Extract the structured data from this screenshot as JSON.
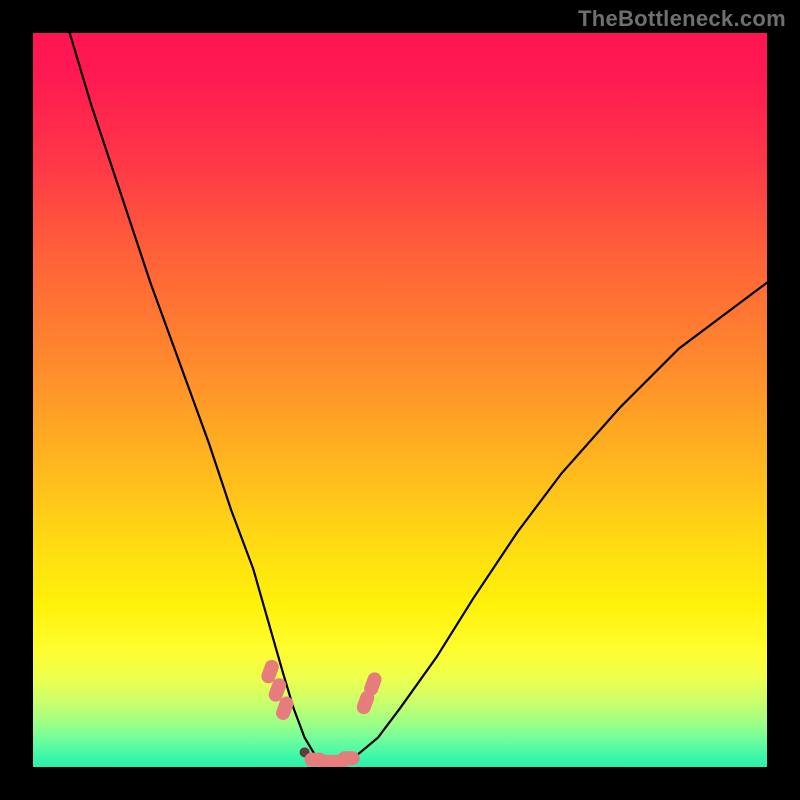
{
  "watermark": "TheBottleneck.com",
  "chart_data": {
    "type": "line",
    "title": "",
    "xlabel": "",
    "ylabel": "",
    "xlim": [
      0,
      100
    ],
    "ylim": [
      0,
      100
    ],
    "axes_visible": false,
    "background": "red-yellow-green vertical gradient",
    "series": [
      {
        "name": "bottleneck-curve",
        "x": [
          5,
          8,
          12,
          16,
          20,
          24,
          27,
          30,
          32,
          34,
          35.5,
          37,
          38.5,
          40,
          42,
          44,
          47,
          50,
          55,
          60,
          66,
          72,
          80,
          88,
          96,
          100
        ],
        "values": [
          100,
          90,
          78,
          66,
          55,
          44,
          35,
          27,
          20,
          13,
          8,
          4,
          1.5,
          0.5,
          0.5,
          1.5,
          4,
          8,
          15,
          23,
          32,
          40,
          49,
          57,
          63,
          66
        ]
      }
    ],
    "markers": [
      {
        "x": 32.3,
        "y": 13.0,
        "kind": "pill"
      },
      {
        "x": 33.3,
        "y": 10.5,
        "kind": "pill"
      },
      {
        "x": 34.3,
        "y": 8.0,
        "kind": "pill"
      },
      {
        "x": 37.0,
        "y": 2.0,
        "kind": "dot-dark"
      },
      {
        "x": 38.5,
        "y": 1.0,
        "kind": "pill-h"
      },
      {
        "x": 40.0,
        "y": 0.7,
        "kind": "pill-h"
      },
      {
        "x": 41.5,
        "y": 0.7,
        "kind": "pill-h"
      },
      {
        "x": 43.0,
        "y": 1.2,
        "kind": "pill-h"
      },
      {
        "x": 45.3,
        "y": 8.8,
        "kind": "pill"
      },
      {
        "x": 46.3,
        "y": 11.3,
        "kind": "pill"
      }
    ],
    "gradient_stops_pct": [
      {
        "pct": 0,
        "color": "#ff1452"
      },
      {
        "pct": 18,
        "color": "#ff3847"
      },
      {
        "pct": 45,
        "color": "#ff8a2d"
      },
      {
        "pct": 70,
        "color": "#ffdc12"
      },
      {
        "pct": 88,
        "color": "#edff4e"
      },
      {
        "pct": 96,
        "color": "#6afc9e"
      },
      {
        "pct": 100,
        "color": "#29f0a9"
      }
    ]
  }
}
